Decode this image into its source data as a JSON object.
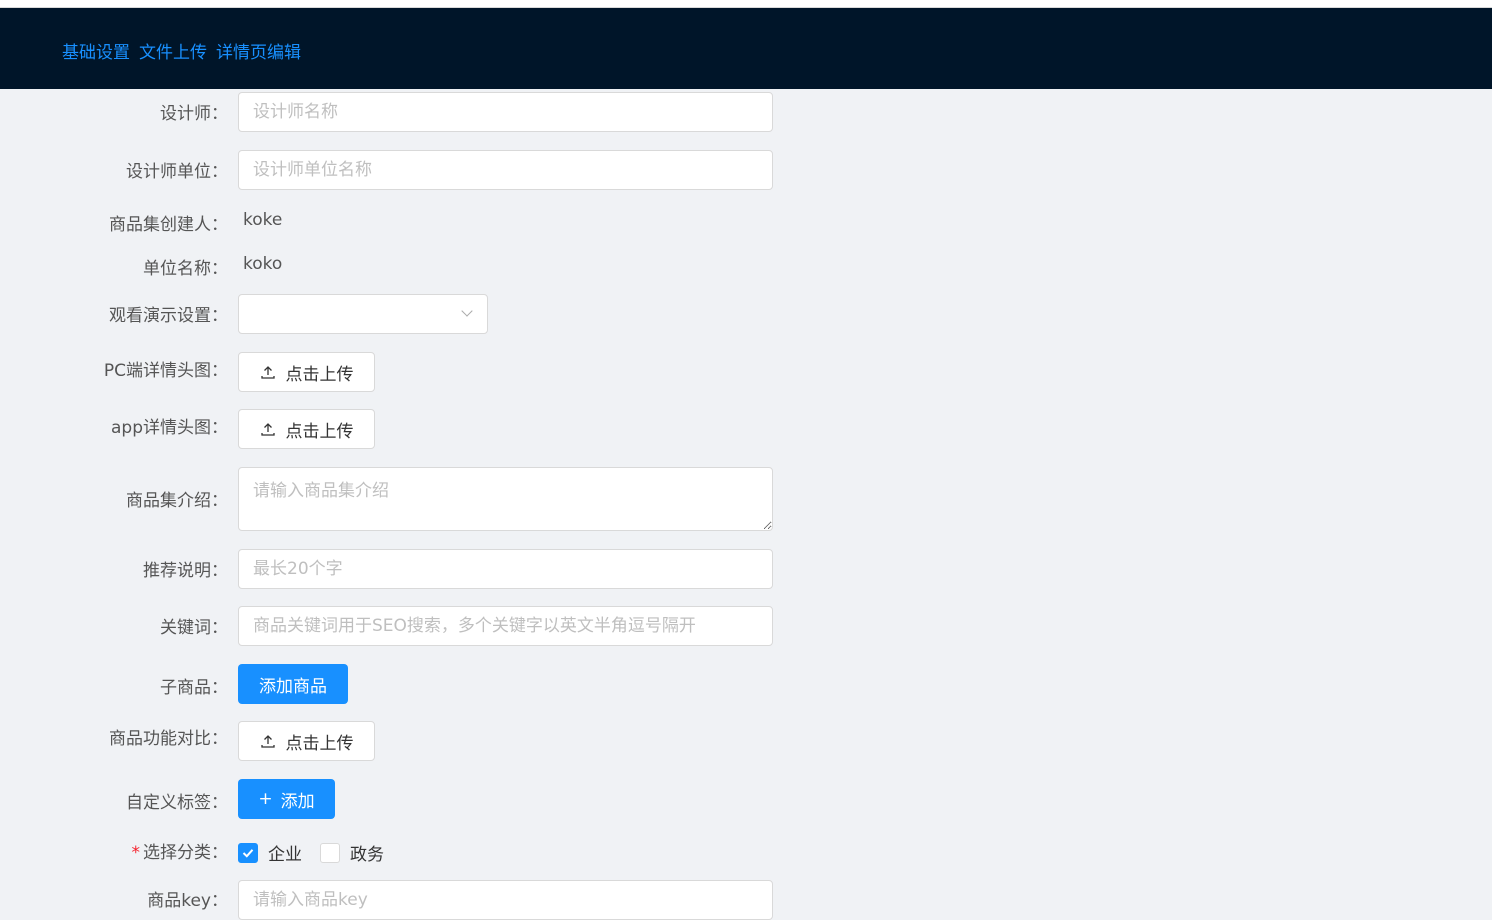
{
  "nav": {
    "items": [
      "基础设置",
      "文件上传",
      "详情页编辑"
    ]
  },
  "form": {
    "designer": {
      "label": "设计师：",
      "placeholder": "设计师名称"
    },
    "designer_org": {
      "label": "设计师单位：",
      "placeholder": "设计师单位名称"
    },
    "creator": {
      "label": "商品集创建人：",
      "value": "koke"
    },
    "org_name": {
      "label": "单位名称：",
      "value": "koko"
    },
    "demo_setting": {
      "label": "观看演示设置：",
      "value": ""
    },
    "pc_header": {
      "label": "PC端详情头图：",
      "button": "点击上传"
    },
    "app_header": {
      "label": "app详情头图：",
      "button": "点击上传"
    },
    "intro": {
      "label": "商品集介绍：",
      "placeholder": "请输入商品集介绍"
    },
    "recommend": {
      "label": "推荐说明：",
      "placeholder": "最长20个字"
    },
    "keywords": {
      "label": "关键词：",
      "placeholder": "商品关键词用于SEO搜索，多个关键字以英文半角逗号隔开"
    },
    "sub_products": {
      "label": "子商品：",
      "button": "添加商品"
    },
    "compare": {
      "label": "商品功能对比：",
      "button": "点击上传"
    },
    "custom_tags": {
      "label": "自定义标签：",
      "button": "添加",
      "button_icon": "+"
    },
    "category": {
      "required_mark": "*",
      "label": "选择分类：",
      "options": [
        {
          "label": "企业",
          "checked": true
        },
        {
          "label": "政务",
          "checked": false
        }
      ]
    },
    "product_key": {
      "label": "商品key：",
      "placeholder": "请输入商品key"
    }
  },
  "colors": {
    "header_bg": "#001529",
    "primary": "#1890ff",
    "page_bg": "#f0f2f5"
  }
}
